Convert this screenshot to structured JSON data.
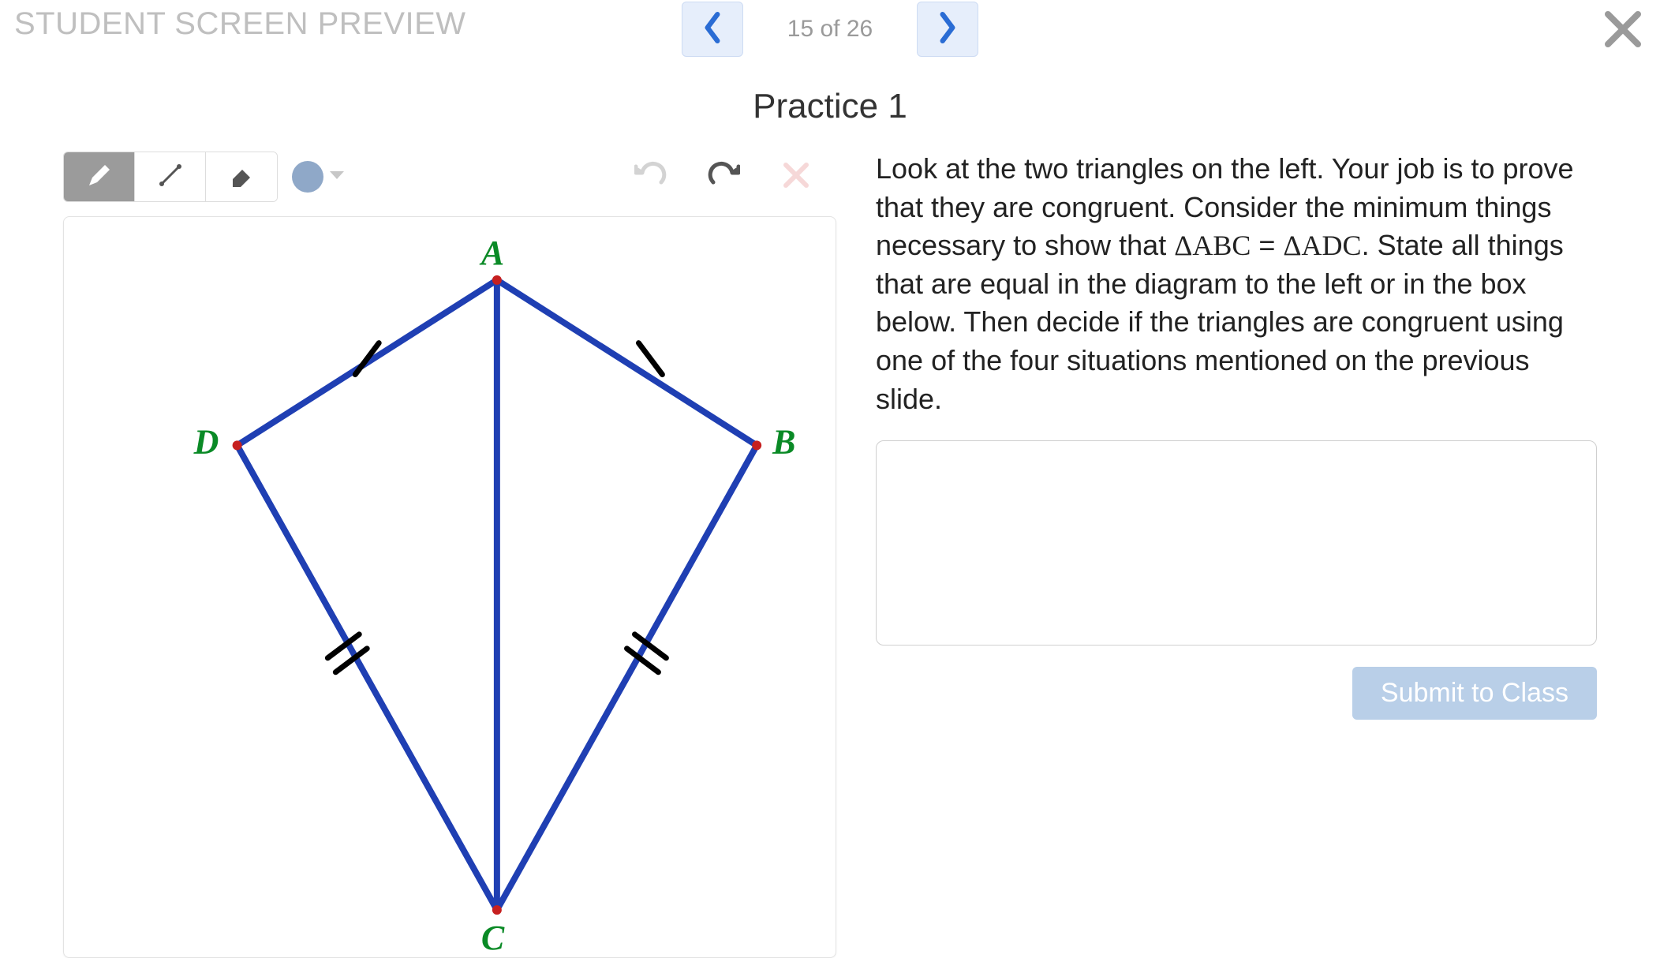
{
  "header": {
    "preview_label": "STUDENT SCREEN PREVIEW",
    "page_counter": "15 of 26"
  },
  "slide": {
    "title": "Practice 1"
  },
  "instructions": {
    "text_part1": "Look at the two triangles on the left. Your job is to prove that they are congruent. Consider the minimum things necessary to show that ",
    "math_lhs": "ΔABC",
    "math_eq": " = ",
    "math_rhs": "ΔADC",
    "text_part2": ". State all things that are equal in the diagram to the left or in the box below. Then decide if the triangles are congruent using one of the four situations mentioned on the previous slide."
  },
  "answer": {
    "value": ""
  },
  "submit": {
    "label": "Submit to Class"
  },
  "diagram": {
    "vertices": {
      "A": "A",
      "B": "B",
      "C": "C",
      "D": "D"
    }
  },
  "icons": {
    "pencil": "pencil-icon",
    "line": "line-icon",
    "eraser": "eraser-icon",
    "color": "color-swatch-icon",
    "undo": "undo-icon",
    "redo": "redo-icon",
    "clear": "clear-icon",
    "prev": "chevron-left-icon",
    "next": "chevron-right-icon",
    "close": "close-icon"
  }
}
